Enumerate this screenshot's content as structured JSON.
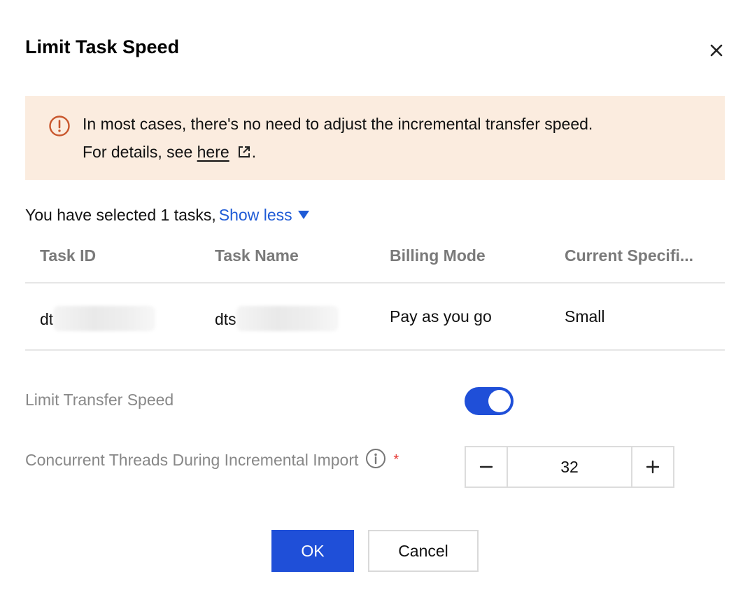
{
  "dialog": {
    "title": "Limit Task Speed",
    "close_icon": "close-icon"
  },
  "alert": {
    "icon": "warning-circle-icon",
    "line1": "In most cases, there's no need to adjust the incremental transfer speed.",
    "line2_prefix": "For details, see ",
    "link_text": "here",
    "link_icon": "external-link-icon",
    "line2_suffix": ".",
    "background_color": "#fbecdf",
    "icon_color": "#c8562c"
  },
  "selection": {
    "summary": "You have selected 1 tasks,",
    "toggle_label": "Show less"
  },
  "table": {
    "columns": [
      "Task ID",
      "Task Name",
      "Billing Mode",
      "Current Specifi..."
    ],
    "rows": [
      {
        "task_id": "dt",
        "task_name": "dts",
        "billing_mode": "Pay as you go",
        "specification": "Small"
      }
    ]
  },
  "form": {
    "limit_label": "Limit Transfer Speed",
    "limit_enabled": true,
    "threads_label": "Concurrent Threads During Incremental Import",
    "threads_info_icon": "info-icon",
    "required_mark": "*",
    "threads_value": "32"
  },
  "footer": {
    "ok_label": "OK",
    "cancel_label": "Cancel"
  },
  "colors": {
    "primary": "#1f4fd8",
    "link": "#1f5bd6",
    "required": "#e53935"
  }
}
